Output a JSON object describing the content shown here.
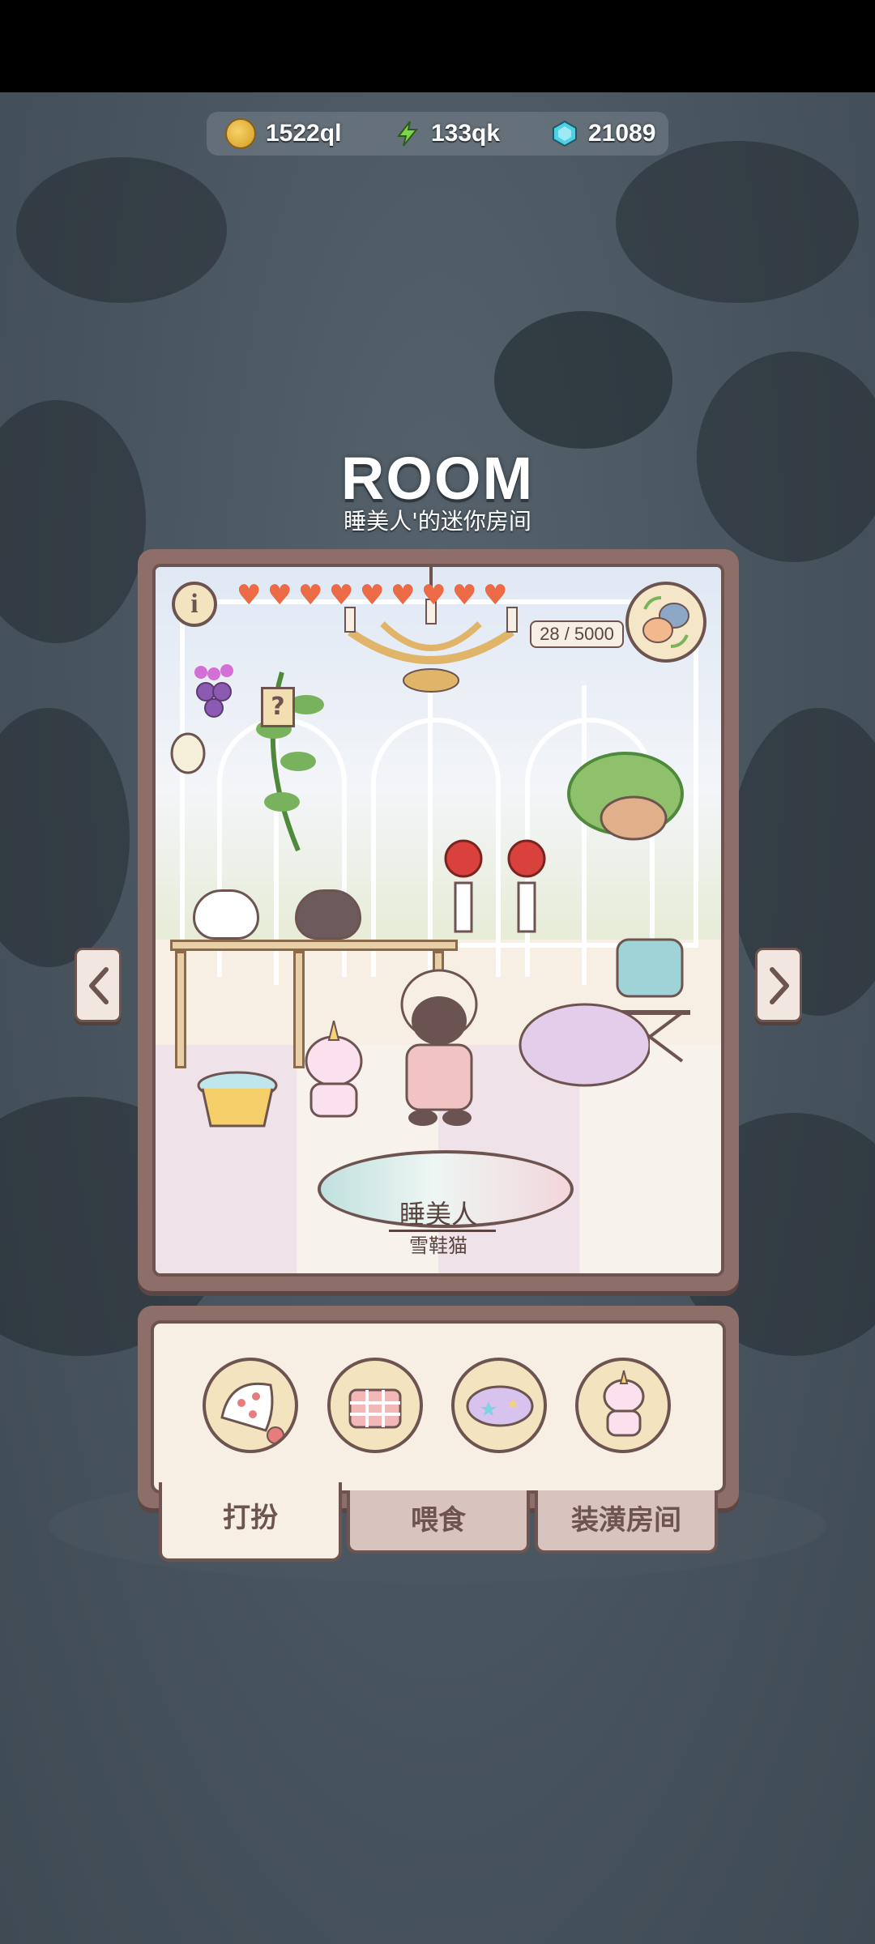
{
  "resources": {
    "coins": "1522ql",
    "energy": "133qk",
    "gems": "21089"
  },
  "header": {
    "title": "ROOM",
    "subtitle": "睡美人'的迷你房间"
  },
  "room": {
    "info_label": "i",
    "hearts_filled": 9,
    "hearts": [
      "♥",
      "♥",
      "♥",
      "♥",
      "♥",
      "♥",
      "♥",
      "♥",
      "♥"
    ],
    "counter": "28 / 5000",
    "mystery_label": "?",
    "pet_name": "睡美人",
    "pet_breed": "雪鞋猫"
  },
  "items": [
    {
      "icon": "polka-dot-sleep-cap-icon"
    },
    {
      "icon": "gingham-top-icon"
    },
    {
      "icon": "star-cloud-icon"
    },
    {
      "icon": "unicorn-pet-icon"
    }
  ],
  "tabs": [
    {
      "label": "打扮",
      "active": true
    },
    {
      "label": "喂食",
      "active": false
    },
    {
      "label": "装潢房间",
      "active": false
    }
  ],
  "colors": {
    "frame": "#8d6e68",
    "paper": "#f7efe4",
    "outline": "#6e5450",
    "heart": "#ec6a45",
    "background": "#3f4a53"
  }
}
